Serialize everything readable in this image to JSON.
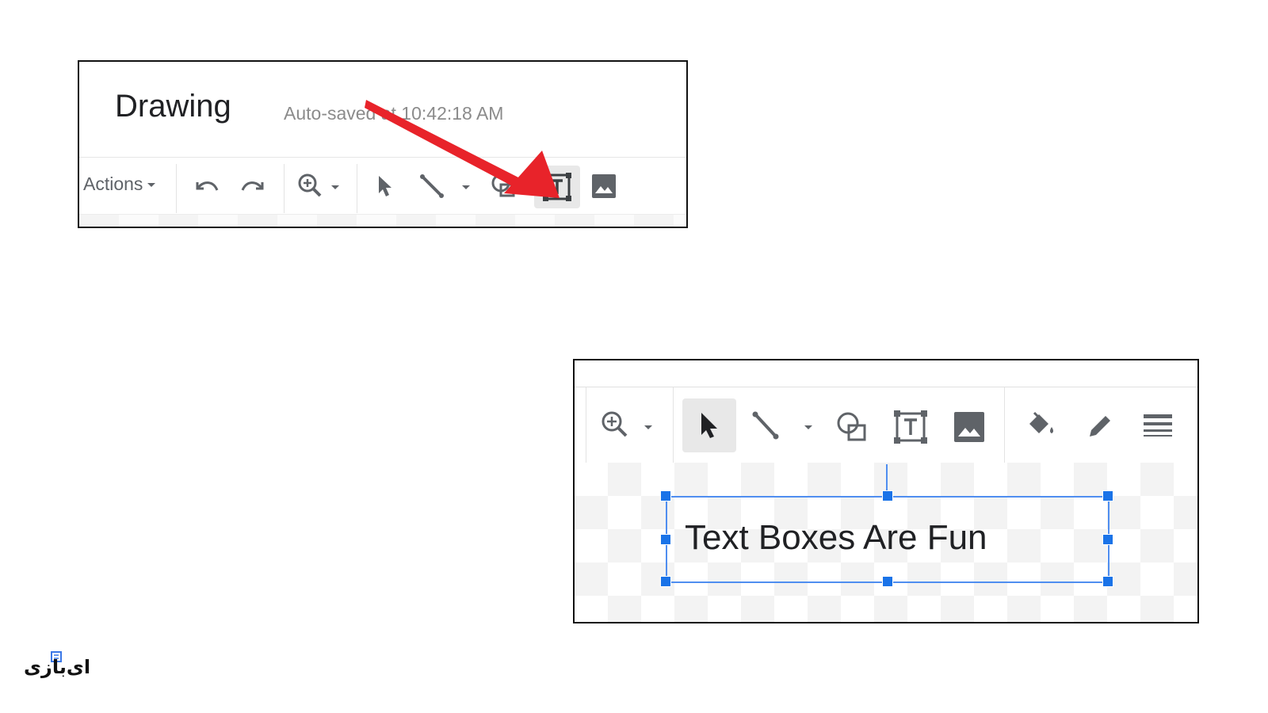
{
  "drawing_panel": {
    "title": "Drawing",
    "autosave_status": "Auto-saved at 10:42:18 AM",
    "toolbar": {
      "actions_label": "Actions",
      "icons": [
        "undo-icon",
        "redo-icon",
        "zoom-icon",
        "select-icon",
        "line-icon",
        "shape-icon",
        "text-box-icon",
        "image-icon"
      ]
    },
    "annotation": {
      "arrow_color": "#e8232a",
      "points_to": "text-box-icon"
    }
  },
  "textbox_panel": {
    "toolbar": {
      "icons": [
        "zoom-icon",
        "select-icon",
        "line-icon",
        "shape-icon",
        "text-box-icon",
        "image-icon",
        "fill-color-icon",
        "pen-icon",
        "line-weight-icon"
      ]
    },
    "text_box": {
      "text": "Text Boxes Are Fun",
      "selection_color": "#1a73e8"
    }
  },
  "watermark": {
    "text": "ای‌بازی"
  }
}
